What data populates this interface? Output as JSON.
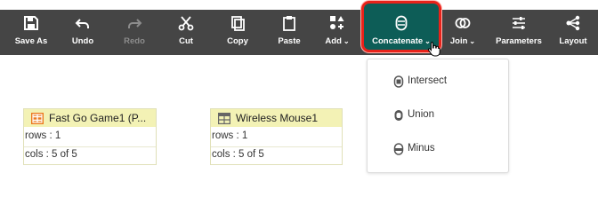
{
  "toolbar": {
    "save_as": "Save As",
    "undo": "Undo",
    "redo": "Redo",
    "cut": "Cut",
    "copy": "Copy",
    "paste": "Paste",
    "add": "Add",
    "concatenate": "Concatenate",
    "join": "Join",
    "parameters": "Parameters",
    "layout": "Layout",
    "caret": "⌄"
  },
  "concatenate_menu": {
    "items": [
      {
        "label": "Intersect",
        "icon": "intersect-icon"
      },
      {
        "label": "Union",
        "icon": "union-icon"
      },
      {
        "label": "Minus",
        "icon": "minus-icon"
      }
    ]
  },
  "nodes": [
    {
      "title": "Fast Go Game1 (P...",
      "rows": "rows : 1",
      "cols": "cols : 5 of 5",
      "icon": "table-icon-orange"
    },
    {
      "title": "Wireless Mouse1",
      "rows": "rows : 1",
      "cols": "cols : 5 of 5",
      "icon": "table-icon-gray"
    }
  ],
  "colors": {
    "toolbar_bg": "#454545",
    "active_bg": "#0d5d57",
    "highlight_border": "#e8221a",
    "node_header": "#f3f2b5"
  }
}
